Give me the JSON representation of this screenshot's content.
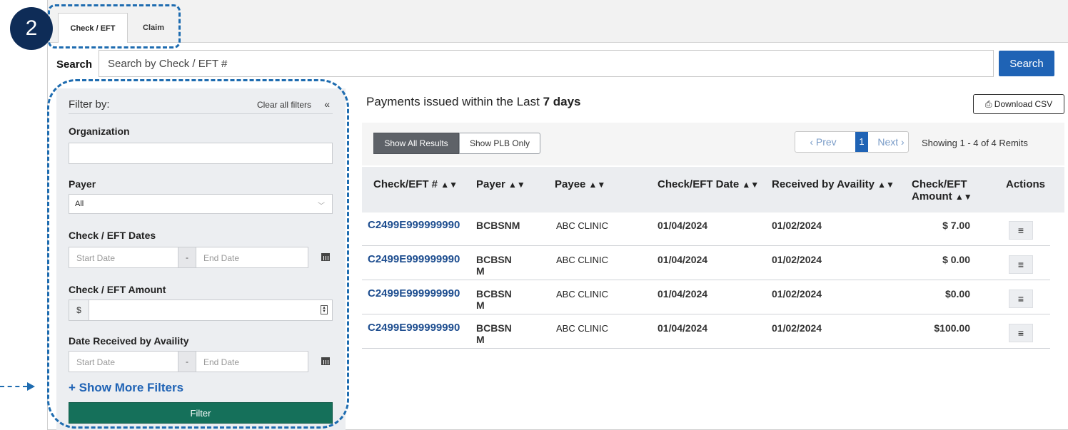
{
  "step_badge": "2",
  "tabs": [
    {
      "label": "Check / EFT",
      "active": true
    },
    {
      "label": "Claim",
      "active": false
    }
  ],
  "search": {
    "label": "Search",
    "placeholder": "Search by Check / EFT #",
    "button_label": "Search"
  },
  "filters": {
    "title": "Filter by:",
    "clear_all": "Clear all filters",
    "collapse_icon": "«",
    "organization_label": "Organization",
    "payer_label": "Payer",
    "payer_value": "All",
    "check_dates_label": "Check / EFT Dates",
    "check_amount_label": "Check / EFT Amount",
    "amount_prefix": "$",
    "date_received_label": "Date Received by Availity",
    "start_date_placeholder": "Start Date",
    "end_date_placeholder": "End Date",
    "date_separator": "-",
    "show_more": "+ Show More Filters",
    "filter_button": "Filter"
  },
  "main": {
    "title_prefix": "Payments issued within the Last ",
    "title_bold": "7 days",
    "download_csv": "Download CSV",
    "show_all": "Show All Results",
    "show_plb": "Show PLB Only",
    "pager": {
      "prev": "‹ Prev",
      "current": "1",
      "next": "Next ›"
    },
    "showing": "Showing 1 - 4 of 4 Remits"
  },
  "table": {
    "headers": {
      "check": "Check/EFT #",
      "payer": "Payer",
      "payee": "Payee",
      "check_date": "Check/EFT Date",
      "received": "Received by Availity",
      "amount_line1": "Check/EFT",
      "amount_line2": "Amount",
      "actions": "Actions"
    },
    "rows": [
      {
        "check": "C2499E999999990",
        "payer": "BCBSNM",
        "payee": "ABC CLINIC",
        "check_date": "01/04/2024",
        "received": "01/02/2024",
        "amount": "$ 7.00"
      },
      {
        "check": "C2499E999999990",
        "payer": "BCBSN M",
        "payee": "ABC CLINIC",
        "check_date": "01/04/2024",
        "received": "01/02/2024",
        "amount": "$ 0.00"
      },
      {
        "check": "C2499E999999990",
        "payer": "BCBSN M",
        "payee": "ABC CLINIC",
        "check_date": "01/04/2024",
        "received": "01/02/2024",
        "amount": "$0.00"
      },
      {
        "check": "C2499E999999990",
        "payer": "BCBSN M",
        "payee": "ABC CLINIC",
        "check_date": "01/04/2024",
        "received": "01/02/2024",
        "amount": "$100.00"
      }
    ],
    "action_icon": "≡"
  },
  "colors": {
    "primary": "#1f63b5",
    "filter_button": "#15705a",
    "badge": "#0e2c57",
    "annotation": "#1e6cb0"
  }
}
